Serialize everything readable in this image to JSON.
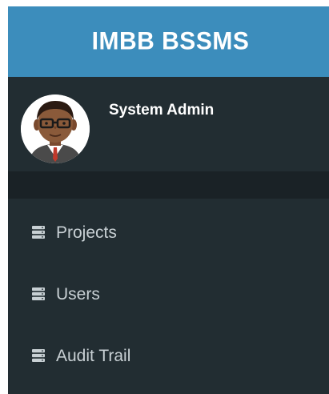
{
  "app": {
    "brand": "IMBB BSSMS"
  },
  "user": {
    "name": "System Admin"
  },
  "menu": {
    "items": [
      {
        "label": "Projects",
        "icon": "server-icon"
      },
      {
        "label": "Users",
        "icon": "server-icon"
      },
      {
        "label": "Audit Trail",
        "icon": "server-icon"
      }
    ]
  },
  "colors": {
    "brand_bg": "#3c8dbc",
    "sidebar_bg": "#222d32",
    "header_bar_bg": "#1a2226",
    "menu_text": "#c8d0d4"
  }
}
